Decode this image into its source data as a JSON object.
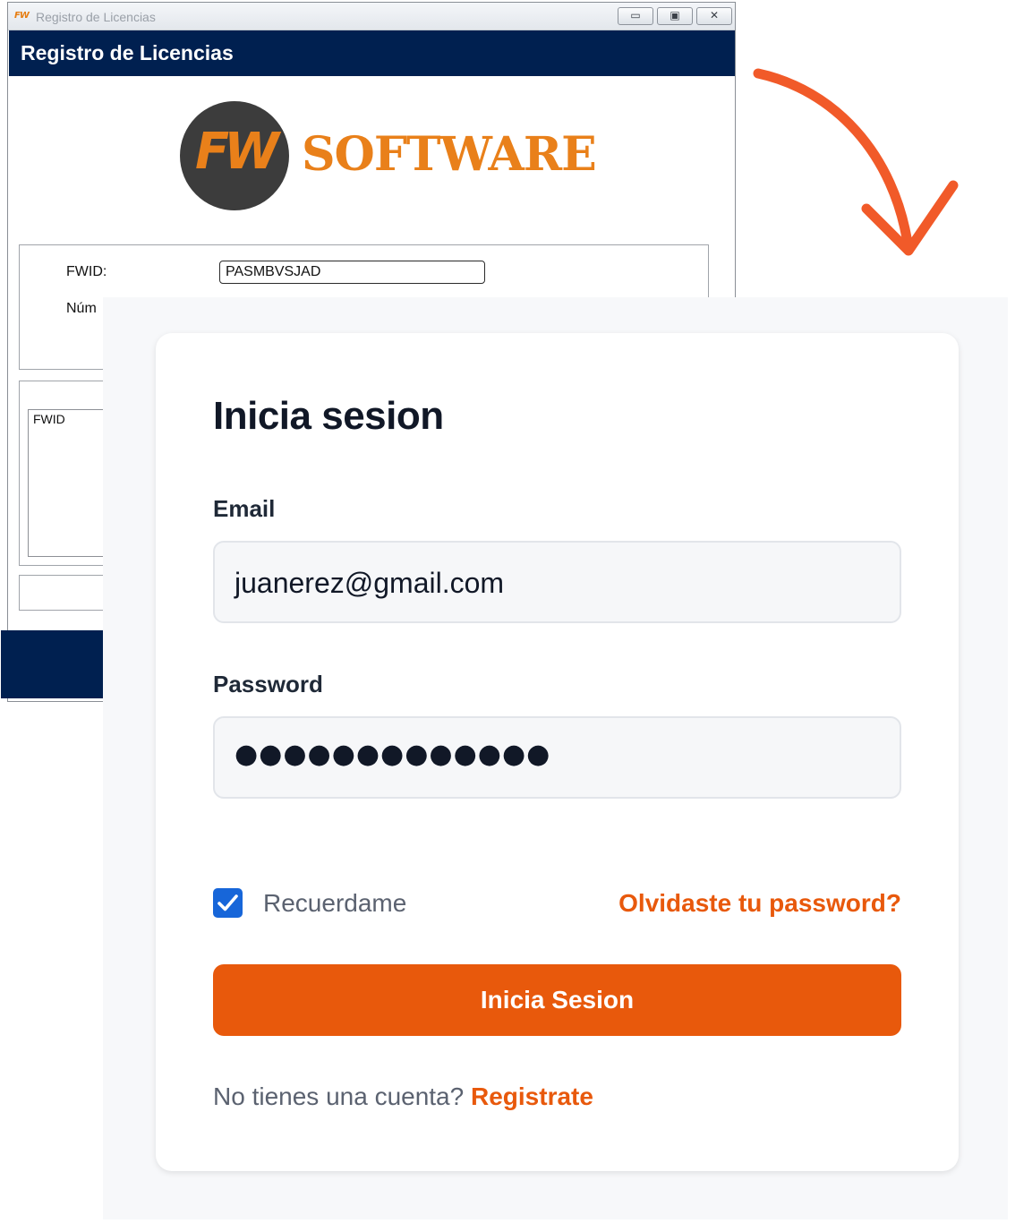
{
  "legacy_window": {
    "titlebar_title": "Registro de Licencias",
    "app_icon_text": "FW",
    "controls": {
      "minimize": "▭",
      "maximize": "▣",
      "close": "✕"
    },
    "header_title": "Registro de Licencias",
    "logo": {
      "mark": "FW",
      "text": "SOFTWARE",
      "brand_color": "#e9801a"
    },
    "fwid_label": "FWID:",
    "number_label_partial": "Núm",
    "fwid_value": "PASMBVSJAD",
    "list_header": "FWID",
    "header_color": "#002050"
  },
  "arrow": {
    "icon": "curved-arrow-down-icon",
    "color": "#f15a29"
  },
  "login": {
    "title": "Inicia sesion",
    "email_label": "Email",
    "email_value": "juanerez@gmail.com",
    "password_label": "Password",
    "password_mask": "●●●●●●●●●●●●●",
    "remember_label": "Recuerdame",
    "remember_checked": true,
    "forgot_link": "Olvidaste tu password?",
    "submit_label": "Inicia Sesion",
    "signup_prompt": "No tienes una cuenta?",
    "signup_link": "Registrate",
    "accent_color": "#e8590c",
    "checkbox_color": "#1766d9"
  }
}
